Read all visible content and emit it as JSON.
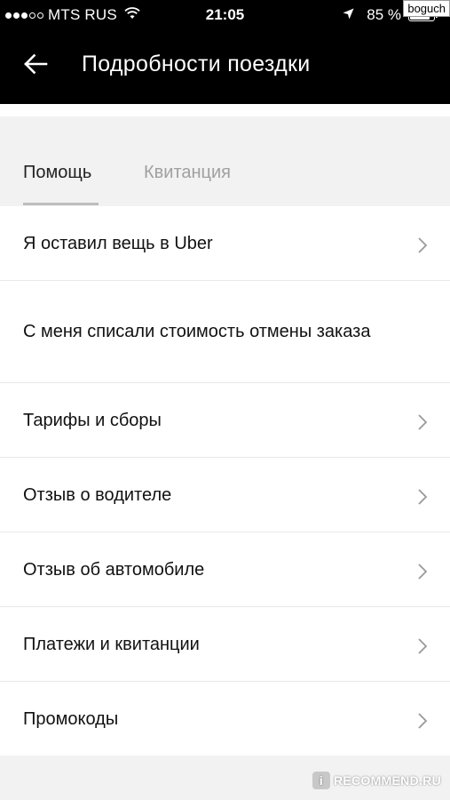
{
  "status_bar": {
    "carrier": "MTS RUS",
    "time": "21:05",
    "battery": "85 %",
    "battery_level": 0.85,
    "signal_bars_filled": 3,
    "signal_bars_total": 5,
    "icons": [
      "wifi-icon",
      "location-arrow-icon",
      "battery-icon"
    ]
  },
  "watermark_user": "boguch",
  "header": {
    "title": "Подробности поездки",
    "back_icon": "arrow-left-icon"
  },
  "tabs": [
    {
      "label": "Помощь",
      "active": true
    },
    {
      "label": "Квитанция",
      "active": false
    }
  ],
  "help_items": [
    {
      "label": "Я оставил вещь в Uber",
      "has_chevron": true
    },
    {
      "label": "С меня списали стоимость отмены заказа",
      "has_chevron": false
    },
    {
      "label": "Тарифы и сборы",
      "has_chevron": true
    },
    {
      "label": "Отзыв о водителе",
      "has_chevron": true
    },
    {
      "label": "Отзыв об автомобиле",
      "has_chevron": true
    },
    {
      "label": "Платежи и квитанции",
      "has_chevron": true
    },
    {
      "label": "Промокоды",
      "has_chevron": true
    }
  ],
  "watermark_site": "RECOMMEND.RU",
  "colors": {
    "header_bg": "#000000",
    "page_bg": "#f2f2f2",
    "list_bg": "#ffffff",
    "active_tab": "#222222",
    "inactive_tab": "#a0a0a0",
    "divider": "#e8e8e8"
  }
}
